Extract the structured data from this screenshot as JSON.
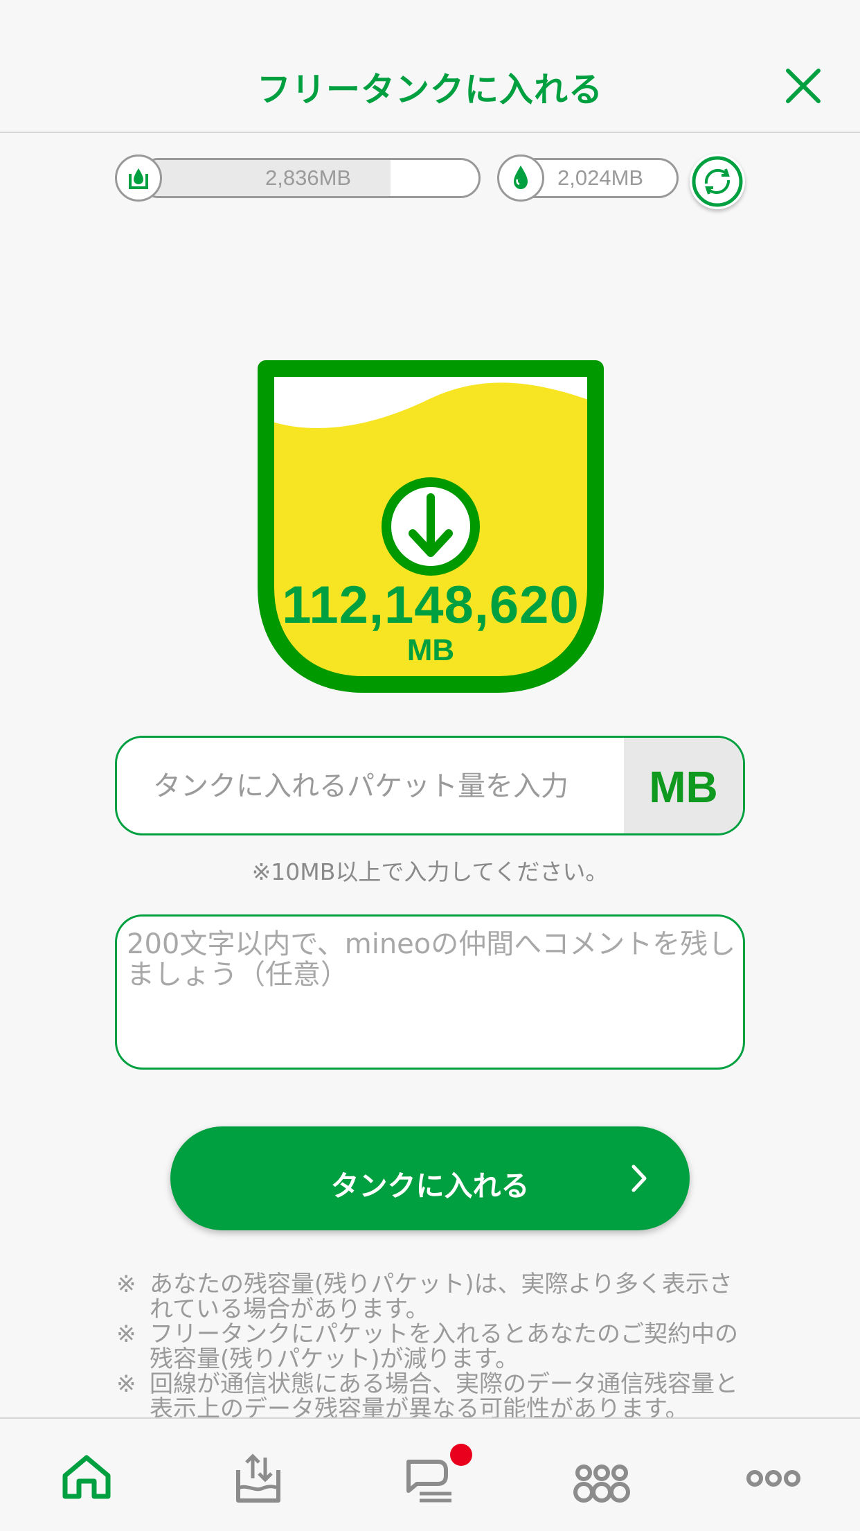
{
  "header": {
    "title": "フリータンクに入れる"
  },
  "status": {
    "tank_capacity": "2,836MB",
    "tank_fill_fraction": 0.74,
    "remaining_packet": "2,024MB"
  },
  "tank": {
    "amount": "112,148,620",
    "unit": "MB"
  },
  "form": {
    "amount_placeholder": "タンクに入れるパケット量を入力",
    "amount_unit": "MB",
    "amount_note": "※10MB以上で入力してください。",
    "comment_placeholder": "200文字以内で、mineoの仲間へコメントを残しましょう（任意）"
  },
  "submit": {
    "label": "タンクに入れる"
  },
  "notes": [
    {
      "mark": "※",
      "text": "あなたの残容量(残りパケット)は、実際より多く表示されている場合があります。"
    },
    {
      "mark": "※",
      "text": "フリータンクにパケットを入れるとあなたのご契約中の残容量(残りパケット)が減ります。"
    },
    {
      "mark": "※",
      "text": "回線が通信状態にある場合、実際のデータ通信残容量と表示上のデータ残容量が異なる可能性があります。"
    }
  ],
  "tabbar": {
    "items": [
      "home-icon",
      "tank-icon",
      "chat-icon",
      "community-icon",
      "more-icon"
    ],
    "active": "home-icon",
    "badge": "chat-icon"
  },
  "colors": {
    "brand_green": "#00a040",
    "dark_green": "#009900",
    "tank_yellow": "#f7e523",
    "badge_red": "#e8001c"
  }
}
